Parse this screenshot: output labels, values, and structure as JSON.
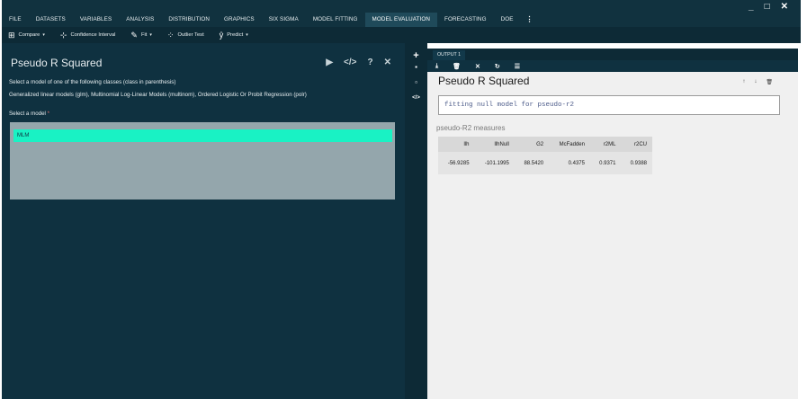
{
  "window": {
    "controls": [
      "_",
      "□",
      "✕"
    ]
  },
  "menu": {
    "items": [
      {
        "label": "FILE",
        "active": false
      },
      {
        "label": "DATASETS",
        "active": false
      },
      {
        "label": "VARIABLES",
        "active": false
      },
      {
        "label": "ANALYSIS",
        "active": false
      },
      {
        "label": "DISTRIBUTION",
        "active": false
      },
      {
        "label": "GRAPHICS",
        "active": false
      },
      {
        "label": "SIX SIGMA",
        "active": false
      },
      {
        "label": "MODEL FITTING",
        "active": false
      },
      {
        "label": "MODEL EVALUATION",
        "active": true
      },
      {
        "label": "FORECASTING",
        "active": false
      },
      {
        "label": "DOE",
        "active": false
      }
    ],
    "more_glyph": "⋮"
  },
  "toolbar": {
    "items": [
      {
        "label": "Compare",
        "icon": "compare-icon",
        "glyph": "⊞",
        "has_caret": true
      },
      {
        "label": "Confidence Interval",
        "icon": "confidence-interval-icon",
        "glyph": "⊹",
        "has_caret": false
      },
      {
        "label": "Fit",
        "icon": "pencil-icon",
        "glyph": "✎",
        "has_caret": true
      },
      {
        "label": "Outlier Test",
        "icon": "scatter-icon",
        "glyph": "⁘",
        "has_caret": false
      },
      {
        "label": "Predict",
        "icon": "predict-icon",
        "glyph": "ŷ",
        "has_caret": true
      }
    ],
    "caret": "▾"
  },
  "left_panel": {
    "title": "Pseudo R Squared",
    "actions": {
      "run": "▶",
      "code": "</>",
      "help": "?",
      "close": "✕"
    },
    "description_line1": "Select a model of one of the following classes (class in parenthesis)",
    "description_line2": "Generalized linear models (glm), Multinomial Log-Linear Models (multinom), Ordered Logistic Or Probit Regression (polr)",
    "select_label": "Select a model",
    "required_mark": "*",
    "models": [
      "MLM"
    ],
    "selected_model": "MLM"
  },
  "sidebar": {
    "add": "+",
    "save": "▪",
    "window": "▫",
    "code": "</>"
  },
  "output": {
    "tab_label": "OUTPUT 1",
    "toolbar": {
      "export": "⤓",
      "delete": "🗑",
      "close": "✕",
      "refresh": "↻",
      "list": "☰"
    },
    "title": "Pseudo R Squared",
    "item_actions": {
      "up": "↑",
      "down": "↓",
      "delete": "🗑"
    },
    "code_line": "fitting null model for pseudo-r2",
    "table_title": "pseudo-R2 measures",
    "table": {
      "headers": [
        "llh",
        "llhNull",
        "G2",
        "McFadden",
        "r2ML",
        "r2CU"
      ],
      "rows": [
        [
          "-56.9285",
          "-101.1995",
          "88.5420",
          "0.4375",
          "0.9371",
          "0.9388"
        ]
      ]
    }
  }
}
